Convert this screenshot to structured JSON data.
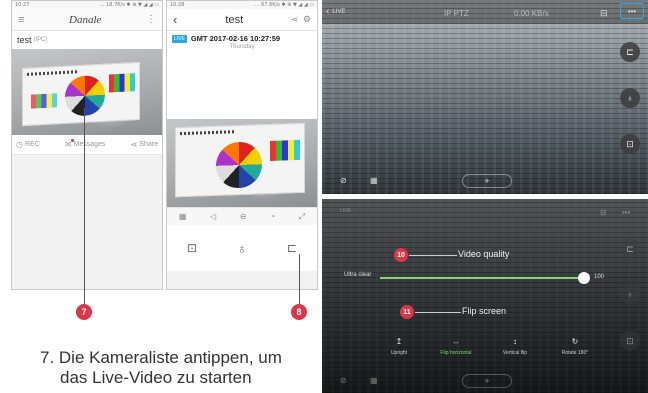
{
  "phone1": {
    "status_time": "10:27",
    "status_icons": "... 18.7K/s ✱ ⊕ ▼ ◢ ◢ ▭",
    "title": "Danale",
    "device_name": "test",
    "device_type": "(IPC)",
    "actions": [
      {
        "label": "REC"
      },
      {
        "label": "Messages"
      },
      {
        "label": "Share"
      }
    ]
  },
  "phone2": {
    "status_time": "10:28",
    "status_icons": "... 67.6K/s ✱ ⊕ ▼ ◢ ◢ ▭",
    "title": "test",
    "live_badge": "LIVE",
    "datetime": "GMT  2017-02-16  10:27:59",
    "weekday": "Thursday"
  },
  "live1": {
    "live_label": "LIVE",
    "center_text": "IP PTZ",
    "bitrate": "0.00 KB/s",
    "more_label": "•••"
  },
  "live2": {
    "live_label": "LIVE",
    "video_quality_label": "Video quality",
    "ultra_clear_label": "Ultra clear",
    "quality_value": "100",
    "quality_fraction": 0.98,
    "flip_label": "Flip screen",
    "flip_options": [
      {
        "icon": "↥",
        "label": "Upright"
      },
      {
        "icon": "↔",
        "label": "Flip horizontal"
      },
      {
        "icon": "↕",
        "label": "Vertical flip"
      },
      {
        "icon": "↻",
        "label": "Rotate 180°"
      }
    ]
  },
  "callouts": {
    "c7": "7",
    "c8": "8",
    "c10": "10",
    "c11": "11"
  },
  "caption": {
    "line1": "7. Die Kameraliste antippen, um",
    "line2": "das Live-Video zu starten"
  },
  "colors": {
    "accent": "#2aa8e0",
    "callout": "#d9364a",
    "active": "#7ed86a"
  }
}
